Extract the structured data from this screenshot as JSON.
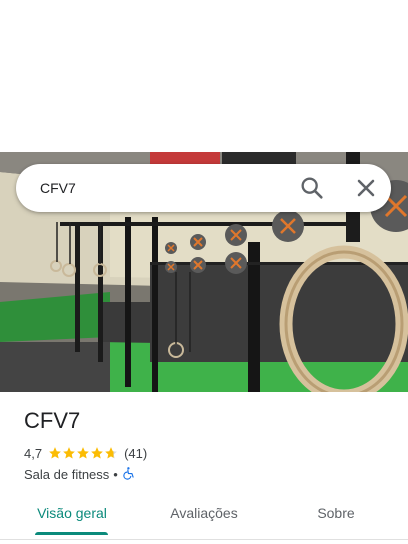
{
  "search": {
    "query": "CFV7"
  },
  "icons": {
    "search": "search-icon",
    "close": "close-icon",
    "wheelchair": "wheelchair-icon",
    "star": "star-icon"
  },
  "place": {
    "name": "CFV7",
    "rating": "4,7",
    "rating_value": 4.7,
    "review_count": "(41)",
    "category": "Sala de fitness",
    "separator": "•"
  },
  "tabs": [
    {
      "label": "Visão geral",
      "active": true
    },
    {
      "label": "Avaliações",
      "active": false
    },
    {
      "label": "Sobre",
      "active": false
    }
  ],
  "colors": {
    "accent": "#0b8a7b",
    "star": "#fbbc04",
    "accessibility": "#1a73e8"
  }
}
